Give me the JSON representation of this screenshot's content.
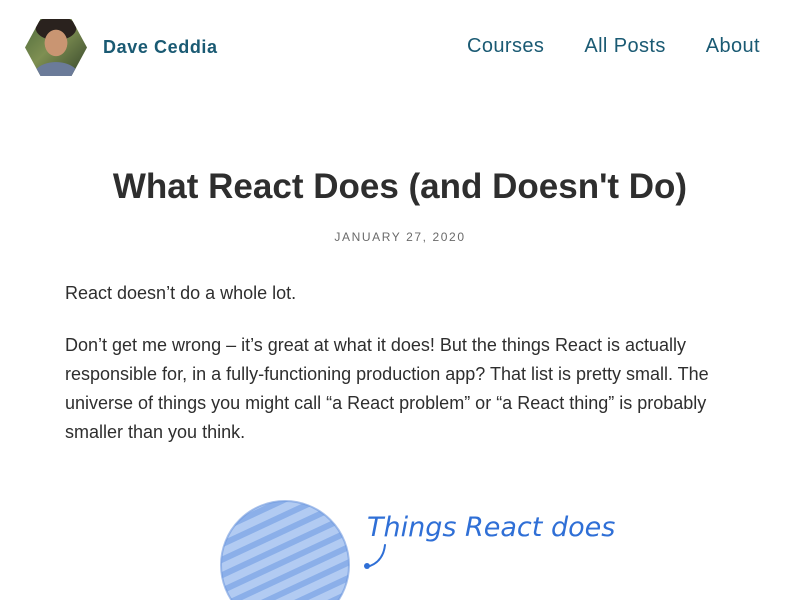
{
  "header": {
    "site_name": "Dave Ceddia",
    "avatar_icon": "author-photo",
    "nav": [
      {
        "label": "Courses"
      },
      {
        "label": "All Posts"
      },
      {
        "label": "About"
      }
    ]
  },
  "article": {
    "title": "What React Does (and Doesn't Do)",
    "date": "JANUARY 27, 2020",
    "paragraphs": [
      "React doesn’t do a whole lot.",
      "Don’t get me wrong – it’s great at what it does! But the things React is actually responsible for, in a fully-functioning production app? That list is pretty small. The universe of things you might call “a React problem” or “a React thing” is probably smaller than you think."
    ],
    "illustration": {
      "caption": "Things React does",
      "circle_color": "#8fb3ea",
      "ink_color": "#2f6fd6"
    }
  },
  "colors": {
    "link": "#1a5a73",
    "text": "#2e2e2e",
    "muted": "#6a6a6a"
  }
}
